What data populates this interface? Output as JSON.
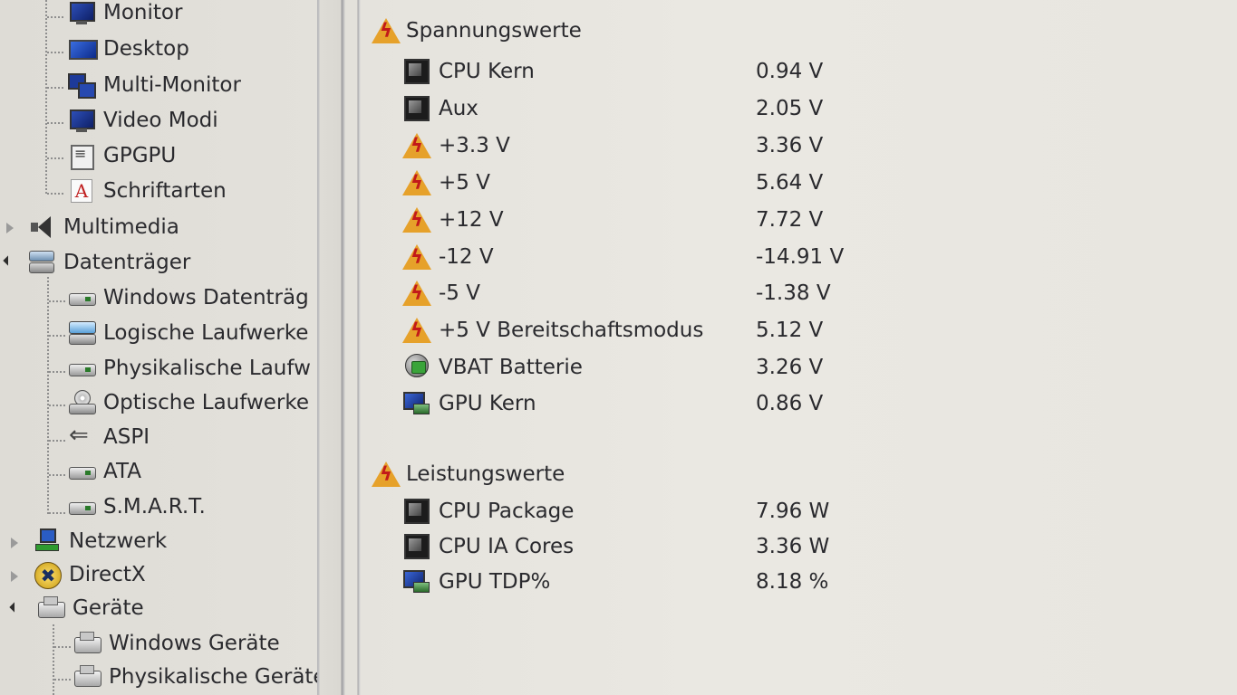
{
  "tree": {
    "items": [
      {
        "label": "Monitor",
        "icon": "monitor-icon"
      },
      {
        "label": "Desktop",
        "icon": "desktop-icon"
      },
      {
        "label": "Multi-Monitor",
        "icon": "multi-monitor-icon"
      },
      {
        "label": "Video Modi",
        "icon": "video-modes-icon"
      },
      {
        "label": "GPGPU",
        "icon": "gpgpu-icon"
      },
      {
        "label": "Schriftarten",
        "icon": "fonts-icon"
      },
      {
        "label": "Multimedia",
        "icon": "speaker-icon",
        "expanded": false
      },
      {
        "label": "Datenträger",
        "icon": "storage-icon",
        "expanded": true
      },
      {
        "label": "Windows Datenträg",
        "icon": "hard-drive-icon"
      },
      {
        "label": "Logische Laufwerke",
        "icon": "logical-drives-icon"
      },
      {
        "label": "Physikalische Laufw",
        "icon": "hard-drive-icon"
      },
      {
        "label": "Optische Laufwerke",
        "icon": "optical-drive-icon"
      },
      {
        "label": "ASPI",
        "icon": "aspi-icon"
      },
      {
        "label": "ATA",
        "icon": "hard-drive-icon"
      },
      {
        "label": "S.M.A.R.T.",
        "icon": "hard-drive-icon"
      },
      {
        "label": "Netzwerk",
        "icon": "network-icon",
        "expanded": false
      },
      {
        "label": "DirectX",
        "icon": "directx-icon",
        "expanded": false
      },
      {
        "label": "Geräte",
        "icon": "devices-icon",
        "expanded": true
      },
      {
        "label": "Windows Geräte",
        "icon": "devices-icon"
      },
      {
        "label": "Physikalische Geräte",
        "icon": "devices-icon"
      }
    ]
  },
  "content": {
    "sections": [
      {
        "title": "Spannungswerte",
        "icon": "warning-icon",
        "rows": [
          {
            "label": "CPU Kern",
            "value": "0.94 V",
            "icon": "cpu-chip-icon"
          },
          {
            "label": "Aux",
            "value": "2.05 V",
            "icon": "cpu-chip-icon"
          },
          {
            "label": "+3.3 V",
            "value": "3.36 V",
            "icon": "warning-icon"
          },
          {
            "label": "+5 V",
            "value": "5.64 V",
            "icon": "warning-icon"
          },
          {
            "label": "+12 V",
            "value": "7.72 V",
            "icon": "warning-icon"
          },
          {
            "label": "-12 V",
            "value": "-14.91 V",
            "icon": "warning-icon"
          },
          {
            "label": "-5 V",
            "value": "-1.38 V",
            "icon": "warning-icon"
          },
          {
            "label": "+5 V Bereitschaftsmodus",
            "value": "5.12 V",
            "icon": "warning-icon"
          },
          {
            "label": "VBAT Batterie",
            "value": "3.26 V",
            "icon": "battery-icon"
          },
          {
            "label": "GPU Kern",
            "value": "0.86 V",
            "icon": "gpu-icon"
          }
        ]
      },
      {
        "title": "Leistungswerte",
        "icon": "warning-icon",
        "rows": [
          {
            "label": "CPU Package",
            "value": "7.96 W",
            "icon": "cpu-chip-icon"
          },
          {
            "label": "CPU IA Cores",
            "value": "3.36 W",
            "icon": "cpu-chip-icon"
          },
          {
            "label": "GPU TDP%",
            "value": "8.18 %",
            "icon": "gpu-icon"
          }
        ]
      }
    ]
  },
  "colors": {
    "background": "#e4e2dc",
    "text": "#2a2a2e",
    "warning": "#e6a12a",
    "warning_bolt": "#c21a1a"
  }
}
